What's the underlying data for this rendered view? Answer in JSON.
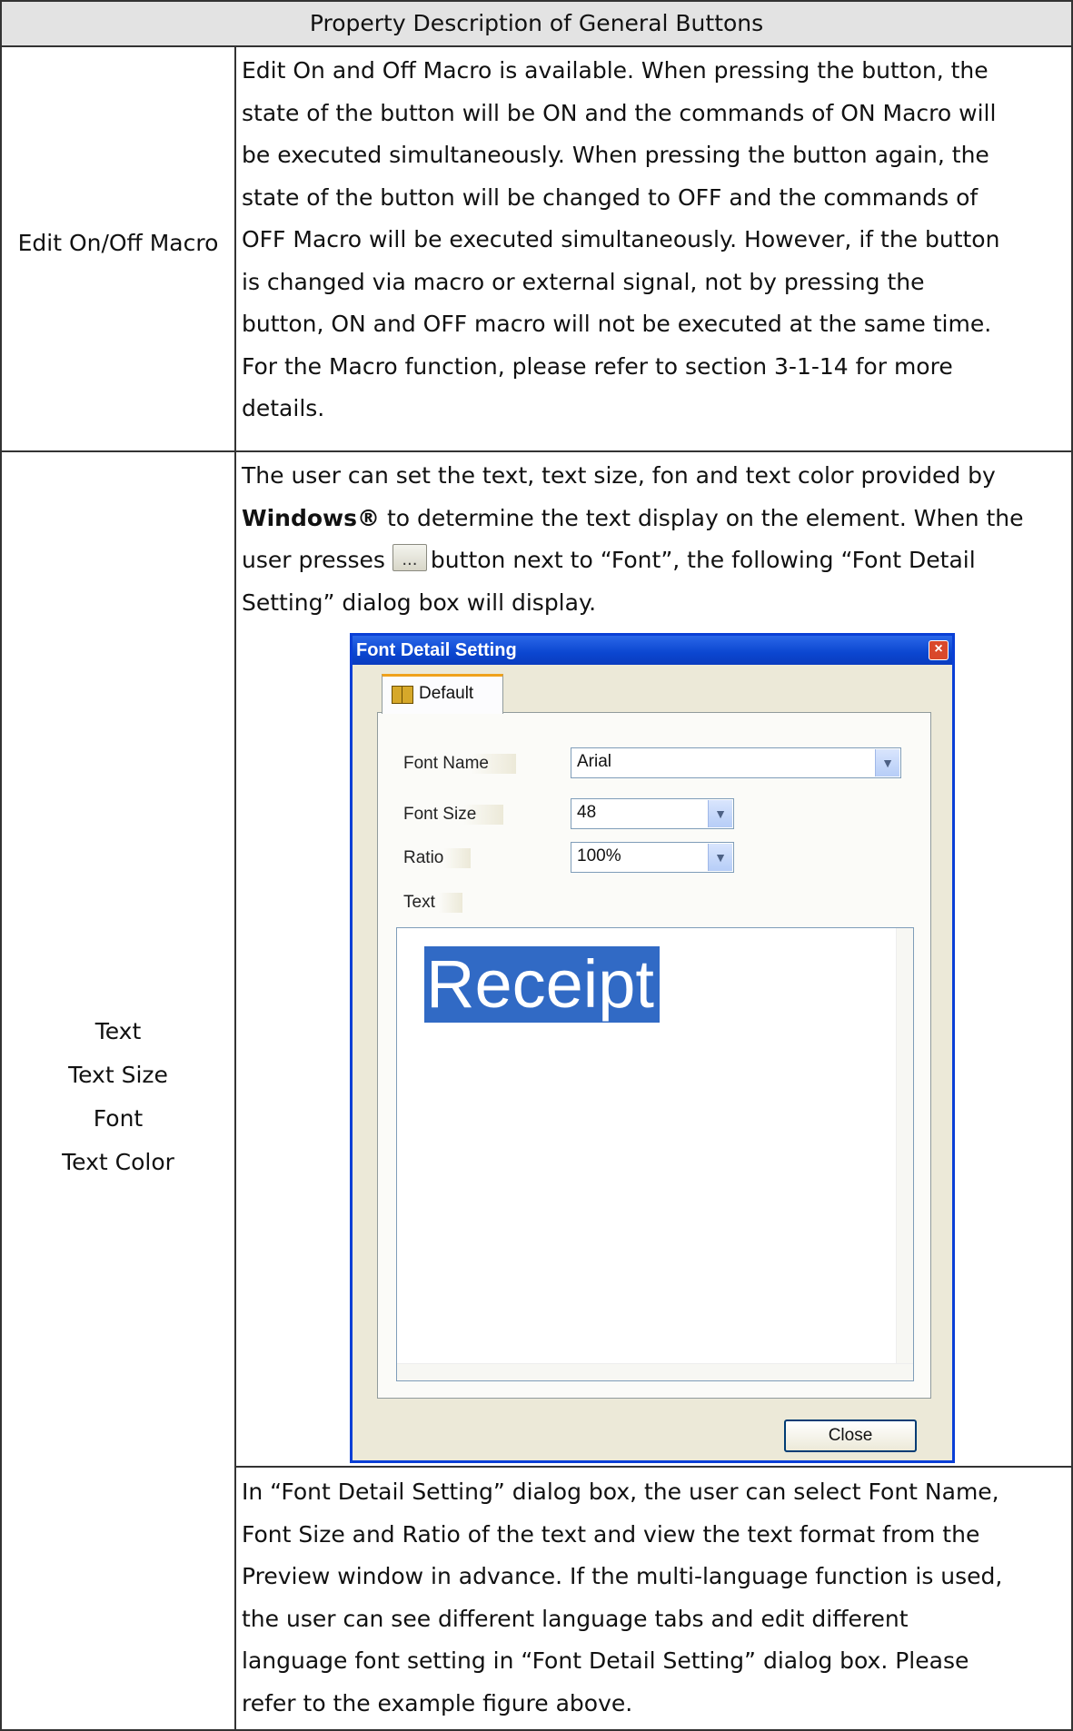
{
  "table": {
    "header": "Property Description of General Buttons",
    "row1": {
      "label": "Edit On/Off Macro",
      "lines": [
        "Edit On and Off Macro is available. When pressing the button, the",
        "state of the button will be ON and the commands of ON Macro will",
        "be executed simultaneously. When pressing the button again, the",
        "state of the button will be changed to OFF and the commands of",
        "OFF Macro will be executed simultaneously. However, if the button",
        "is changed via macro or external signal, not by pressing the",
        "button, ON and OFF macro will not be executed at the same time.",
        "For the Macro function, please refer to section 3-1-14 for more",
        "details."
      ]
    },
    "row2": {
      "labels": [
        "Text",
        "Text Size",
        "Font",
        "Text Color"
      ],
      "line1": "The user can set the text, text size, fon and text color provided by",
      "bold_word": "Windows®",
      "line2_rest": " to determine the text display on the element. When the",
      "line3_pre": "user presses",
      "inline_button_glyph": "...",
      "line3_post": "button next to “Font”, the following “Font Detail",
      "line4": "Setting” dialog box will display.",
      "after_lines": [
        "In “Font Detail Setting” dialog box, the user can select Font Name,",
        "Font Size and Ratio of the text and view the text format from the",
        "Preview window in advance. If the multi-language function is used,",
        "the user can see different language tabs and edit different",
        "language font setting in “Font Detail Setting” dialog box. Please",
        "refer to the example figure above."
      ]
    }
  },
  "dialog": {
    "title": "Font Detail Setting",
    "close_x": "×",
    "tab": "Default",
    "fields": {
      "font_name_label": "Font Name",
      "font_name_value": "Arial",
      "font_size_label": "Font Size",
      "font_size_value": "48",
      "ratio_label": "Ratio",
      "ratio_value": "100%",
      "text_label": "Text"
    },
    "preview_text": "Receipt",
    "close_button": "Close"
  },
  "colors": {
    "title_bar": "#0b46d0",
    "selection": "#316ac5",
    "dialog_bg": "#ece9d8",
    "header_bg": "#e3e3e3"
  },
  "icons": [
    "ellipsis-button-icon",
    "book-icon",
    "dropdown-arrow-icon",
    "close-icon"
  ]
}
